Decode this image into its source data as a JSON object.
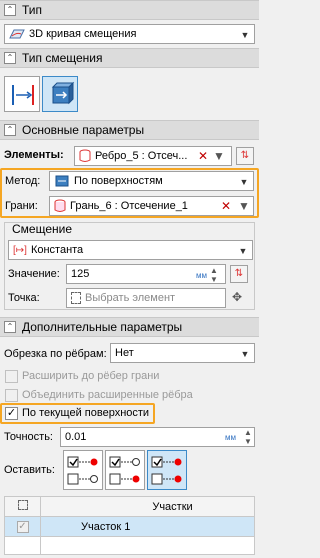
{
  "type_section": {
    "title": "Тип",
    "value": "3D кривая смещения"
  },
  "offset_type_section": {
    "title": "Тип смещения"
  },
  "main_params": {
    "title": "Основные параметры",
    "elements_label": "Элементы:",
    "elements_value": "Ребро_5 : Отсеч...",
    "method_label": "Метод:",
    "method_value": "По поверхностям",
    "faces_label": "Грани:",
    "faces_value": "Грань_6 : Отсечение_1"
  },
  "offset": {
    "title": "Смещение",
    "kind": "Константа",
    "value_label": "Значение:",
    "value": "125",
    "units": "мм",
    "point_label": "Точка:",
    "point_placeholder": "Выбрать элемент"
  },
  "extra_params": {
    "title": "Дополнительные параметры",
    "trim_label": "Обрезка по рёбрам:",
    "trim_value": "Нет",
    "extend_to_face_edges": "Расширить до рёбер грани",
    "merge_extended_edges": "Объединить расширенные рёбра",
    "by_current_surface": "По текущей поверхности",
    "precision_label": "Точность:",
    "precision_value": "0.01",
    "precision_units": "мм",
    "leave_label": "Оставить:"
  },
  "table": {
    "header": "Участки",
    "rows": [
      {
        "name": "Участок 1",
        "checked": true
      }
    ]
  },
  "colors": {
    "accent": "#f5a623",
    "active_bg": "#cfe6f7",
    "red": "#c00000"
  }
}
